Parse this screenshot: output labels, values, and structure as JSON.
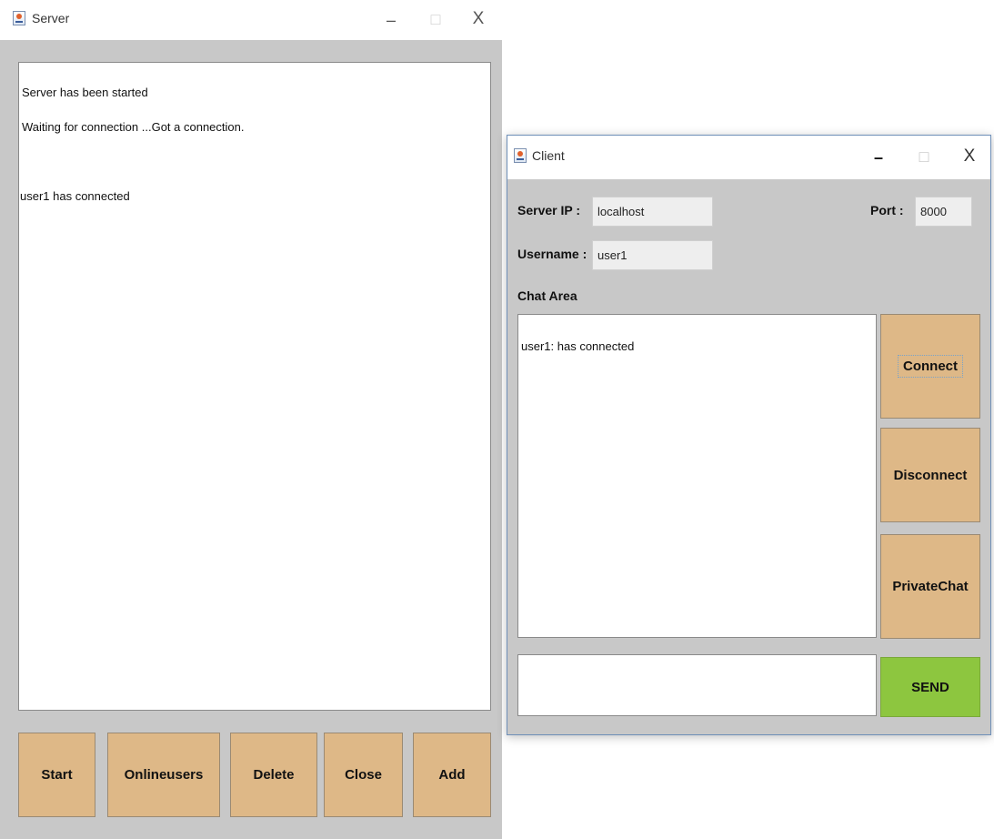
{
  "server_window": {
    "title": "Server",
    "log_lines": [
      "Server has been started",
      "Waiting for connection ...Got a connection.",
      "",
      "user1  has connected"
    ],
    "buttons": [
      "Start",
      "Onlineusers",
      "Delete",
      "Close",
      "Add"
    ]
  },
  "client_window": {
    "title": "Client",
    "server_ip_label": "Server IP :",
    "server_ip_value": "localhost",
    "port_label": "Port :",
    "port_value": "8000",
    "username_label": "Username :",
    "username_value": "user1",
    "chat_area_label": "Chat Area",
    "chat_text": "user1: has connected",
    "message_input_value": "",
    "connect_label": "Connect",
    "disconnect_label": "Disconnect",
    "privatechat_label": "PrivateChat",
    "send_label": "SEND"
  },
  "window_controls": {
    "minimize": "–",
    "maximize": "□",
    "close": "X"
  },
  "colors": {
    "button_tan": "#deb887",
    "send_green": "#8dc63f",
    "window_bg": "#c8c8c8"
  }
}
